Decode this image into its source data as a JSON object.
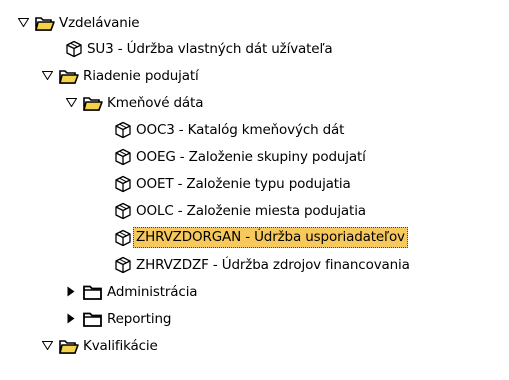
{
  "tree": {
    "items": [
      {
        "label": "Vzdelávanie",
        "type": "folder",
        "state": "expanded",
        "level": 0
      },
      {
        "label": "SU3 - Údržba vlastných dát užívateľa",
        "type": "transaction",
        "level": 1
      },
      {
        "label": "Riadenie podujatí",
        "type": "folder",
        "state": "expanded",
        "level": 1
      },
      {
        "label": "Kmeňové dáta",
        "type": "folder",
        "state": "expanded",
        "level": 2
      },
      {
        "label": "OOC3 - Katalóg kmeňových dát",
        "type": "transaction",
        "level": 3
      },
      {
        "label": "OOEG - Založenie skupiny podujatí",
        "type": "transaction",
        "level": 3
      },
      {
        "label": "OOET - Založenie typu podujatia",
        "type": "transaction",
        "level": 3
      },
      {
        "label": "OOLC - Založenie miesta podujatia",
        "type": "transaction",
        "level": 3
      },
      {
        "label": "ZHRVZDORGAN - Údržba usporiadateľov",
        "type": "transaction",
        "level": 3,
        "selected": true
      },
      {
        "label": "ZHRVZDZF - Údržba zdrojov financovania",
        "type": "transaction",
        "level": 3
      },
      {
        "label": "Administrácia",
        "type": "folder",
        "state": "collapsed",
        "level": 2
      },
      {
        "label": "Reporting",
        "type": "folder",
        "state": "collapsed",
        "level": 2
      },
      {
        "label": "Kvalifikácie",
        "type": "folder",
        "state": "expanded",
        "level": 1
      }
    ]
  },
  "colors": {
    "selection": "#f7c95c",
    "folder_fill": "#ffffff",
    "folder_stroke": "#000000"
  },
  "icons": {
    "expanded": "triangle-down-icon",
    "collapsed": "triangle-right-icon",
    "folder_open": "folder-open-icon",
    "folder_closed": "folder-closed-icon",
    "transaction": "cube-icon"
  }
}
